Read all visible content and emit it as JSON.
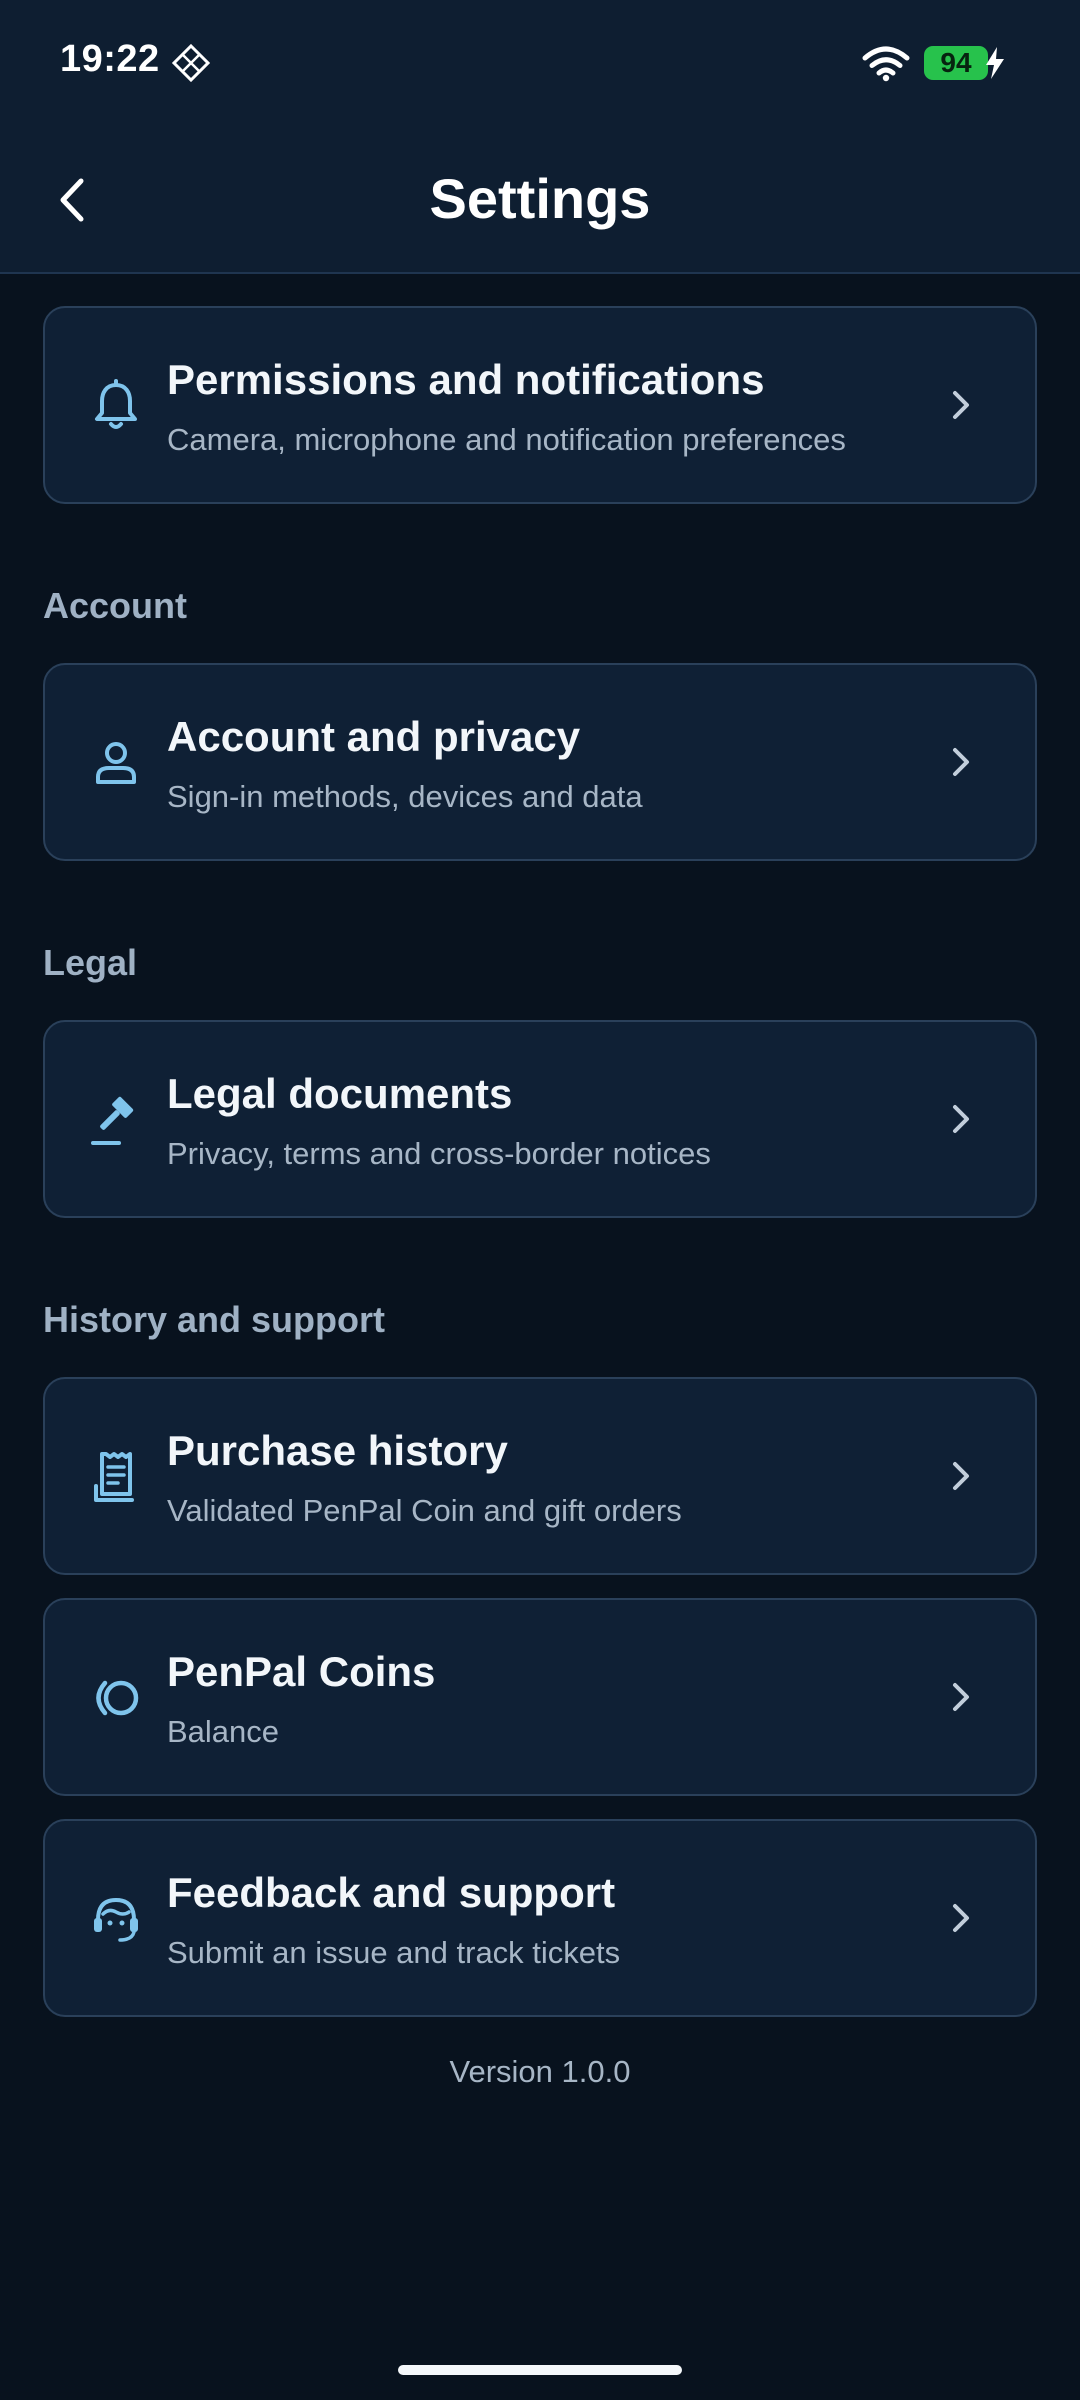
{
  "status_bar": {
    "time": "19:22",
    "battery_level": "94",
    "icons": [
      "diamond-grid-icon",
      "wifi-icon",
      "battery-icon",
      "charging-bolt-icon"
    ]
  },
  "app_bar": {
    "title": "Settings",
    "back_icon": "chevron-left-icon"
  },
  "sections": {
    "account": "Account",
    "legal": "Legal",
    "history_support": "History and support"
  },
  "items": [
    {
      "title": "Permissions and notifications",
      "subtitle": "Camera, microphone and notification preferences",
      "icon": "bell-icon"
    },
    {
      "title": "Account and privacy",
      "subtitle": "Sign-in methods, devices and data",
      "icon": "person-icon"
    },
    {
      "title": "Legal documents",
      "subtitle": "Privacy, terms and cross-border notices",
      "icon": "gavel-icon"
    },
    {
      "title": "Purchase history",
      "subtitle": "Validated PenPal Coin and gift orders",
      "icon": "receipt-icon"
    },
    {
      "title": "PenPal Coins",
      "subtitle": "Balance",
      "icon": "coins-icon"
    },
    {
      "title": "Feedback and support",
      "subtitle": "Submit an issue and track tickets",
      "icon": "headset-icon"
    }
  ],
  "footer": {
    "version": "Version 1.0.0"
  },
  "colors": {
    "background": "#08121e",
    "app_bar": "#0e1e31",
    "card": "#0f2035",
    "card_border": "#2a405a",
    "accent": "#7fc4ec",
    "battery": "#27c24c"
  }
}
